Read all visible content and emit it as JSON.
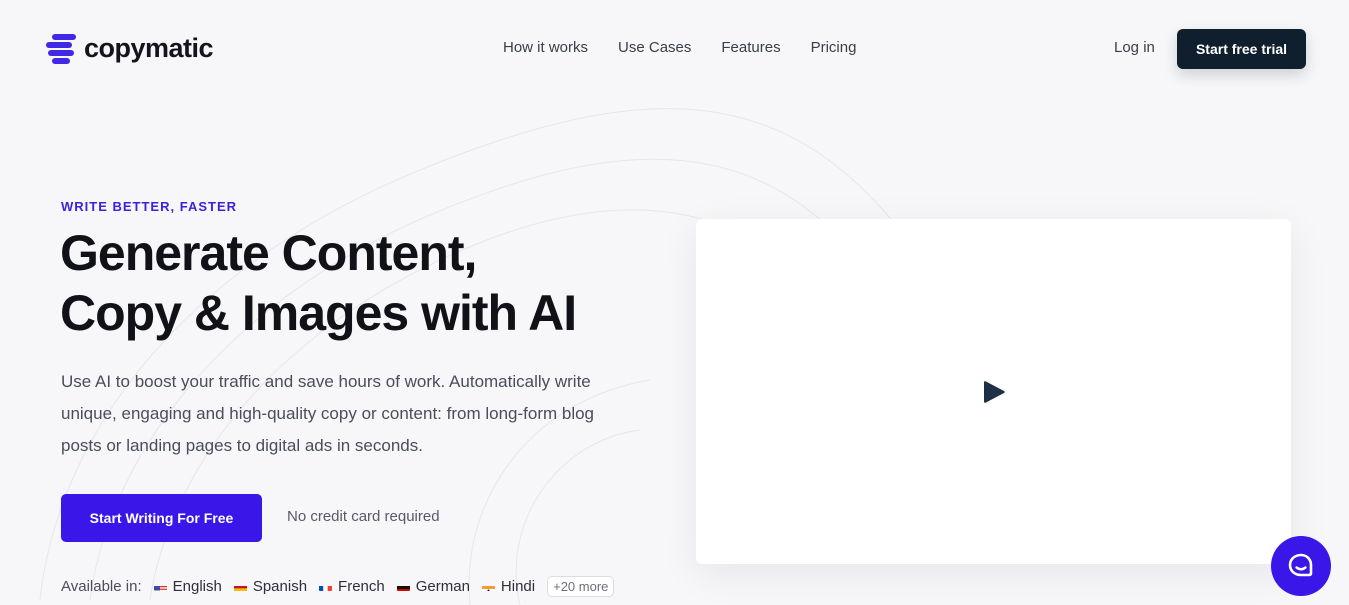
{
  "brand": {
    "name": "copymatic",
    "accent": "#3b16e8"
  },
  "nav": {
    "items": [
      {
        "label": "How it works"
      },
      {
        "label": "Use Cases"
      },
      {
        "label": "Features"
      },
      {
        "label": "Pricing"
      }
    ],
    "login": "Log in",
    "trial": "Start free trial"
  },
  "hero": {
    "eyebrow": "WRITE BETTER, FASTER",
    "headline_line1": "Generate Content,",
    "headline_line2": "Copy & Images with AI",
    "description": "Use AI to boost your traffic and save hours of work. Automatically write unique, engaging and high-quality copy or content: from long-form blog posts or landing pages to digital ads in seconds.",
    "cta": "Start Writing For Free",
    "cta_note": "No credit card required"
  },
  "languages": {
    "label": "Available in:",
    "items": [
      {
        "name": "English",
        "icon": "us-flag-icon"
      },
      {
        "name": "Spanish",
        "icon": "spain-flag-icon"
      },
      {
        "name": "French",
        "icon": "france-flag-icon"
      },
      {
        "name": "German",
        "icon": "germany-flag-icon"
      },
      {
        "name": "Hindi",
        "icon": "india-flag-icon"
      }
    ],
    "more": "+20 more"
  },
  "video": {
    "icon": "play-icon"
  },
  "support": {
    "icon": "chat-bubble-icon"
  }
}
